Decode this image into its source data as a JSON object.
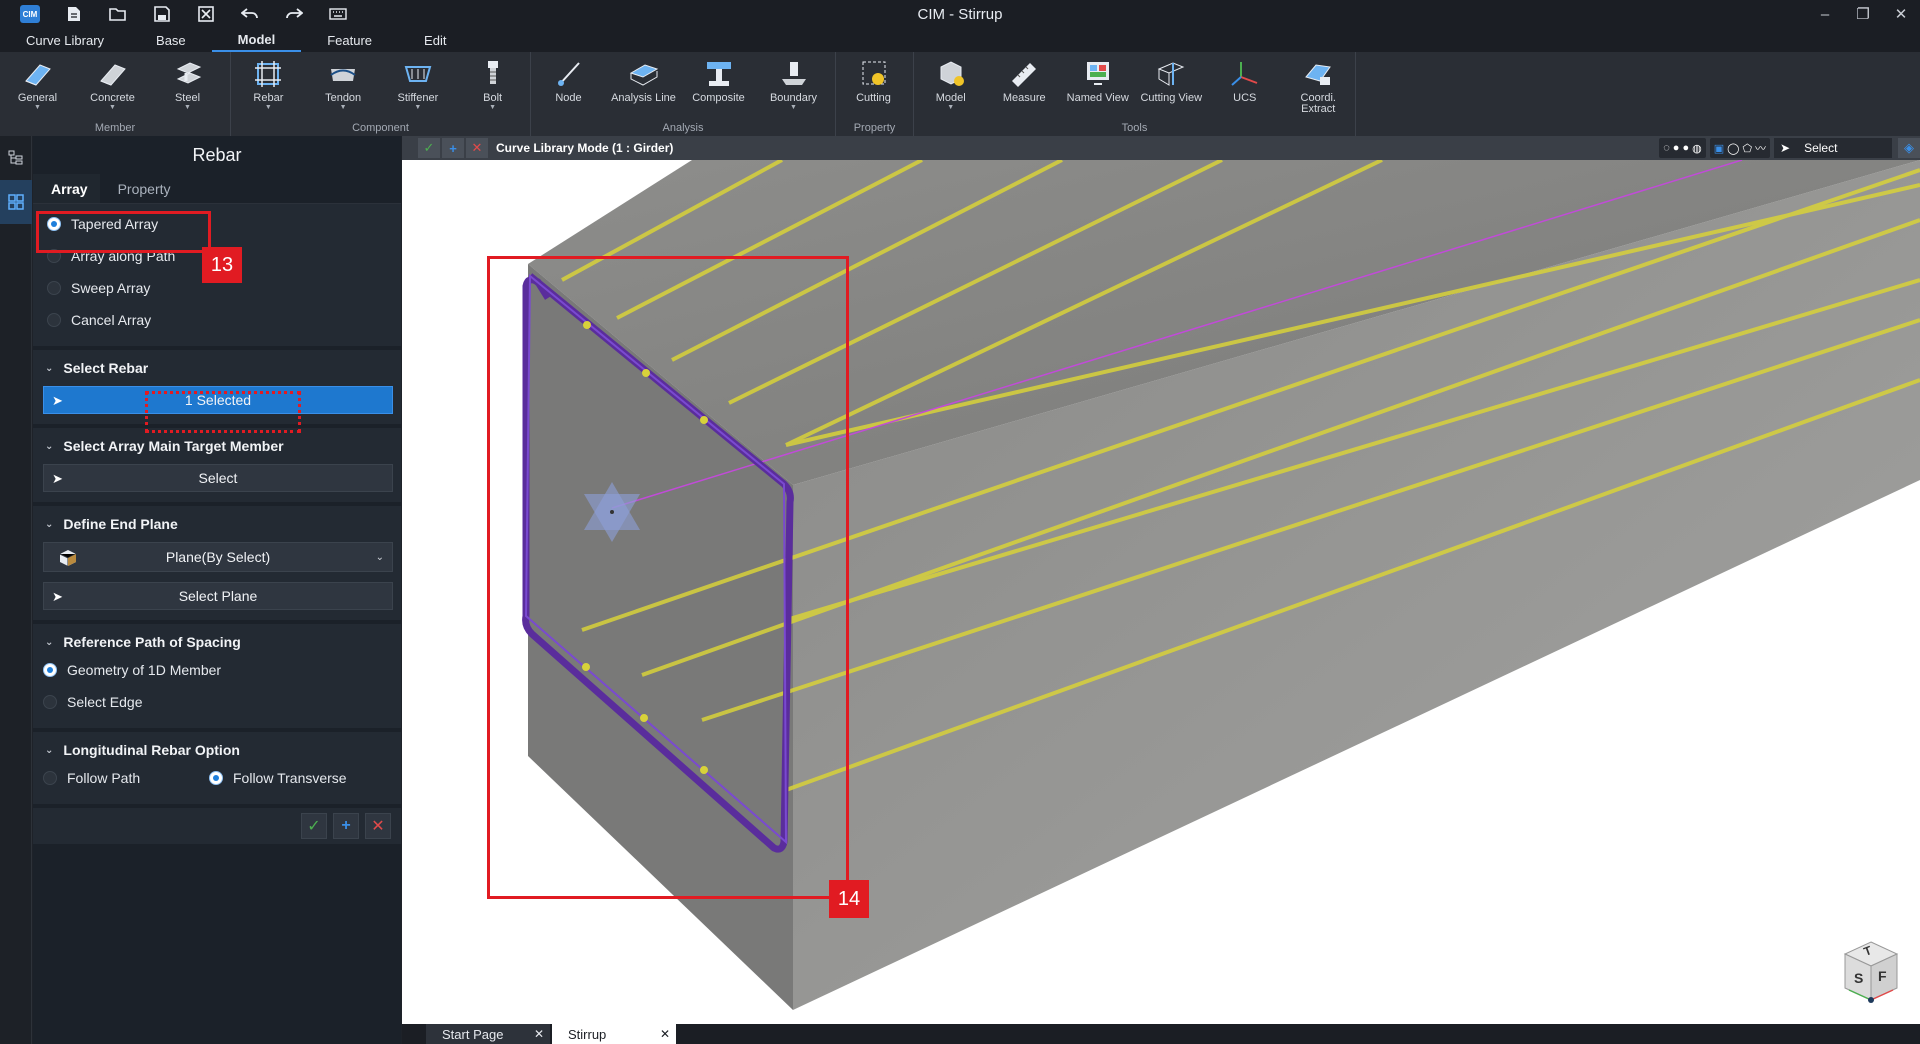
{
  "app": {
    "title": "CIM - Stirrup",
    "logo": "CIM"
  },
  "quick_toolbar": {
    "icons": [
      "new-file-icon",
      "open-folder-icon",
      "save-icon",
      "close-document-icon",
      "undo-icon",
      "redo-icon",
      "keyboard-icon"
    ]
  },
  "window_controls": {
    "minimize": "–",
    "restore": "❐",
    "close": "✕"
  },
  "menu": {
    "tabs": [
      "Curve Library",
      "Base",
      "Model",
      "Feature",
      "Edit"
    ],
    "active": "Model"
  },
  "ribbon": {
    "groups": [
      {
        "label": "Member",
        "buttons": [
          {
            "label": "General",
            "dropdown": true
          },
          {
            "label": "Concrete",
            "dropdown": true
          },
          {
            "label": "Steel",
            "dropdown": true
          }
        ]
      },
      {
        "label": "Component",
        "buttons": [
          {
            "label": "Rebar",
            "dropdown": true
          },
          {
            "label": "Tendon",
            "dropdown": true
          },
          {
            "label": "Stiffener",
            "dropdown": true
          },
          {
            "label": "Bolt",
            "dropdown": true
          }
        ]
      },
      {
        "label": "Analysis",
        "buttons": [
          {
            "label": "Node",
            "dropdown": false
          },
          {
            "label": "Analysis Line",
            "dropdown": false
          },
          {
            "label": "Composite",
            "dropdown": false
          },
          {
            "label": "Boundary",
            "dropdown": true
          }
        ]
      },
      {
        "label": "Property",
        "buttons": [
          {
            "label": "Cutting",
            "dropdown": false
          }
        ]
      },
      {
        "label": "Tools",
        "buttons": [
          {
            "label": "Model",
            "dropdown": true
          },
          {
            "label": "Measure",
            "dropdown": false
          },
          {
            "label": "Named View",
            "dropdown": false
          },
          {
            "label": "Cutting View",
            "dropdown": false
          },
          {
            "label": "UCS",
            "dropdown": false
          },
          {
            "label": "Coordi. Extract",
            "dropdown": false
          }
        ]
      }
    ]
  },
  "panel": {
    "title": "Rebar",
    "tabs": [
      "Array",
      "Property"
    ],
    "array_types": [
      "Tapered Array",
      "Array along Path",
      "Sweep Array",
      "Cancel Array"
    ],
    "array_selected": "Tapered Array",
    "select_rebar": {
      "header": "Select Rebar",
      "value": "1 Selected"
    },
    "select_target": {
      "header": "Select Array Main Target Member",
      "value": "Select"
    },
    "end_plane": {
      "header": "Define End Plane",
      "dropdown": "Plane(By Select)",
      "button": "Select Plane"
    },
    "ref_path": {
      "header": "Reference Path of Spacing",
      "options": [
        "Geometry of 1D Member",
        "Select Edge"
      ],
      "selected": "Geometry of 1D Member"
    },
    "long_rebar": {
      "header": "Longitudinal Rebar Option",
      "options": [
        "Follow Path",
        "Follow Transverse"
      ],
      "selected": "Follow Transverse"
    },
    "footer": {
      "ok": "✓",
      "add": "+",
      "cancel": "✕"
    }
  },
  "viewport": {
    "mode_label": "Curve Library Mode (1 : Girder)",
    "select_label": "Select",
    "cube_labels": {
      "top": "T",
      "left": "S",
      "right": "F"
    }
  },
  "doc_tabs": [
    {
      "label": "Start Page"
    },
    {
      "label": "Stirrup",
      "active": true
    }
  ],
  "callouts": {
    "a": "13",
    "b": "14"
  },
  "colors": {
    "accent": "#1e78cf",
    "callout": "#e11b22",
    "rebar_long": "#d8d23a",
    "stirrup": "#5a2d9c"
  }
}
